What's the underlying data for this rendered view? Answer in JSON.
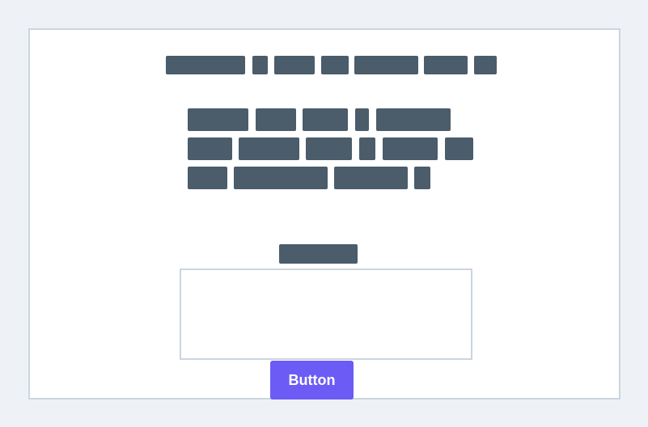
{
  "colors": {
    "page_background": "#eef2f6",
    "card_background": "#ffffff",
    "border": "#cbd5e0",
    "redacted_text": "#4b5c6b",
    "button_background": "#6c5cf5",
    "button_text": "#ffffff"
  },
  "form": {
    "heading": "",
    "description": "",
    "field_label": "",
    "textarea_value": "",
    "button_label": "Button"
  }
}
